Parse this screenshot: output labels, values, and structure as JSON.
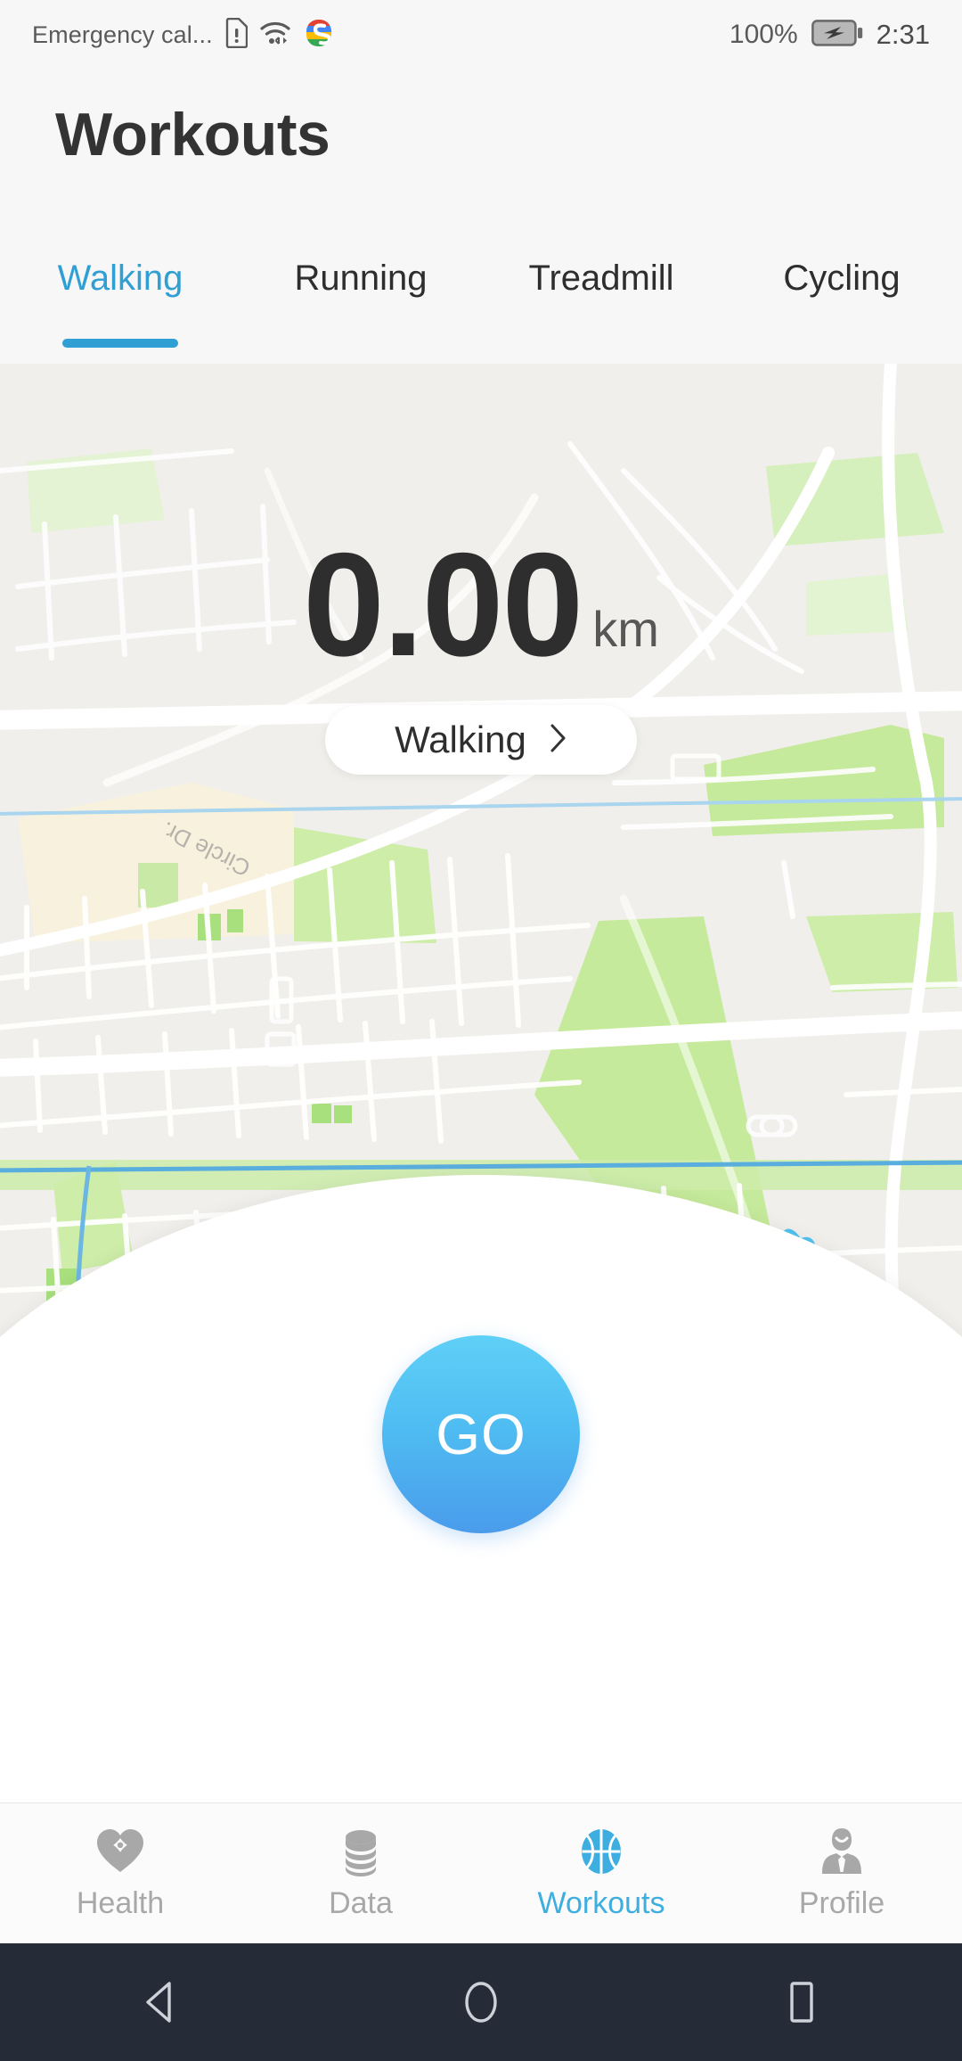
{
  "status_bar": {
    "carrier": "Emergency cal...",
    "sim_alert_icon": "sim-card-alert-icon",
    "wifi_icon": "wifi-icon",
    "app_icon": "s-app-icon",
    "battery_percent": "100%",
    "battery_icon": "battery-charging-icon",
    "clock": "2:31"
  },
  "header": {
    "title": "Workouts"
  },
  "tabs": [
    {
      "label": "Walking",
      "active": true
    },
    {
      "label": "Running",
      "active": false
    },
    {
      "label": "Treadmill",
      "active": false
    },
    {
      "label": "Cycling",
      "active": false
    }
  ],
  "map": {
    "street_label": "Circle Dr.",
    "land_color": "#f1efeb",
    "road_color": "#ffffff",
    "park_color": "#c4ea9e",
    "water_color": "#4fc3f0",
    "stream_color": "#7cc0e8",
    "sand_color": "#f7f0dc"
  },
  "workout": {
    "distance_value": "0.00",
    "distance_unit": "km",
    "activity_label": "Walking",
    "activity_chevron": "chevron-right-icon",
    "go_label": "GO"
  },
  "bottom_nav": [
    {
      "label": "Health",
      "icon": "heart-plus-icon",
      "active": false
    },
    {
      "label": "Data",
      "icon": "coins-stack-icon",
      "active": false
    },
    {
      "label": "Workouts",
      "icon": "basketball-icon",
      "active": true
    },
    {
      "label": "Profile",
      "icon": "person-tie-icon",
      "active": false
    }
  ],
  "android_nav": [
    {
      "icon": "back-triangle-icon"
    },
    {
      "icon": "home-circle-icon"
    },
    {
      "icon": "recents-square-icon"
    }
  ],
  "colors": {
    "accent": "#2f9fd4",
    "accent_nav": "#3eaee0",
    "header_bg": "#f7f7f7",
    "text_dark": "#2e2e2e",
    "text_muted": "#a8a8a8",
    "android_nav_bg": "#252c38",
    "go_gradient_top": "#5fd0f7",
    "go_gradient_bottom": "#4a9ceb"
  }
}
